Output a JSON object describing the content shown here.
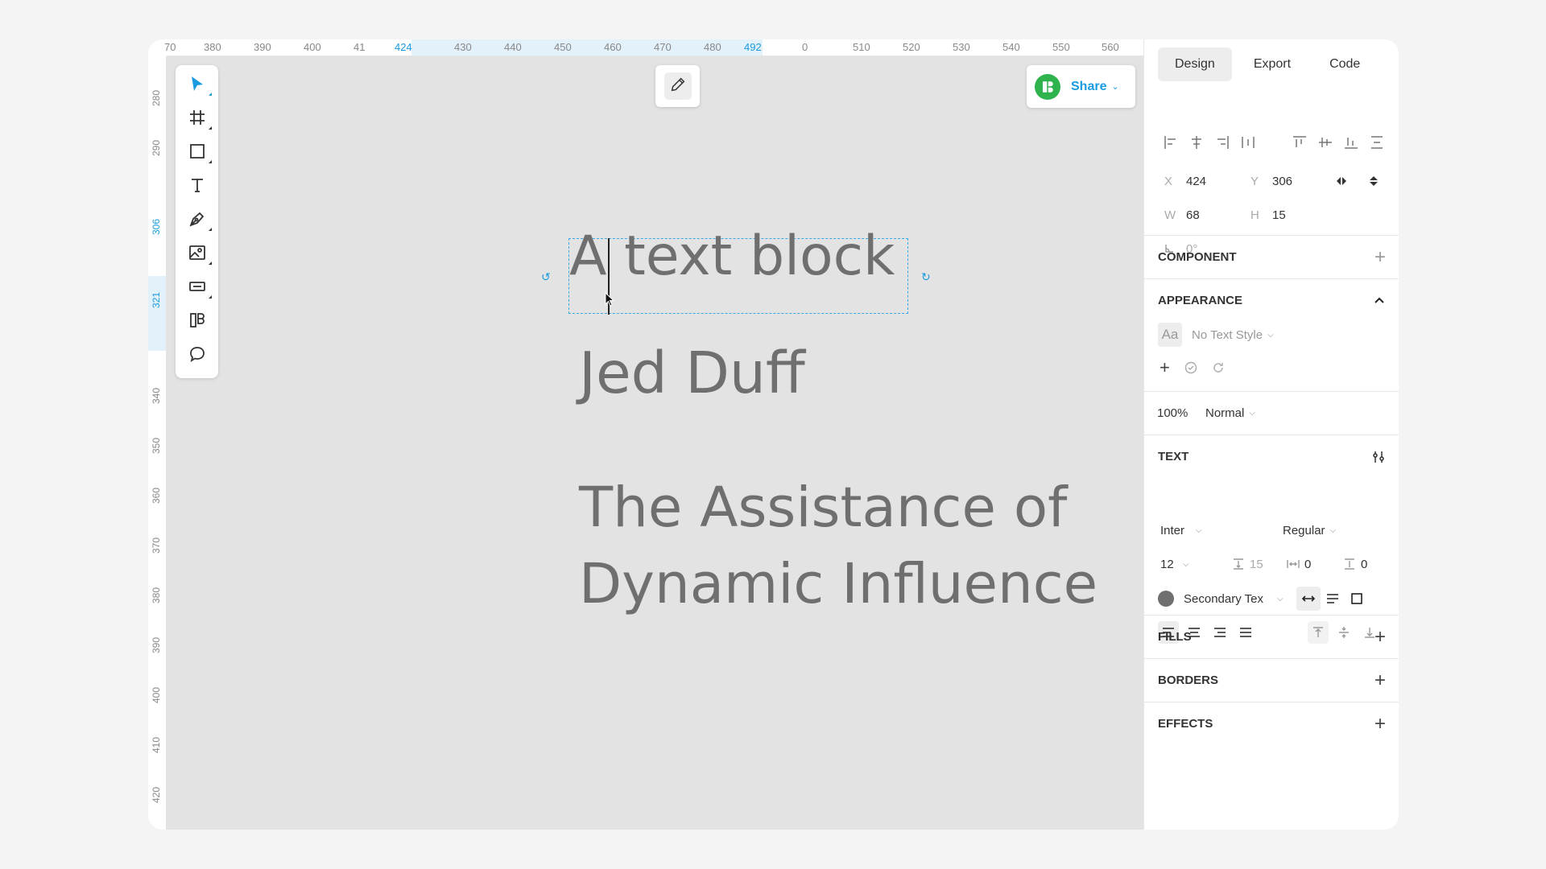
{
  "colors": {
    "accent": "#1a9be0",
    "canvas": "#e3e3e3",
    "text_layer": "#6f6f6f",
    "share_logo": "#2eb34f",
    "swatch": "#6f6f6f"
  },
  "ruler": {
    "x_labels": [
      "70",
      "380",
      "390",
      "400",
      "41",
      "424",
      "430",
      "440",
      "450",
      "460",
      "470",
      "480",
      "492",
      "0",
      "510",
      "520",
      "530",
      "540",
      "550",
      "560"
    ],
    "y_labels": [
      "280",
      "290",
      "306",
      "321",
      "340",
      "350",
      "360",
      "370",
      "380",
      "390",
      "400",
      "410",
      "420"
    ]
  },
  "toolbar": {
    "tools": [
      {
        "name": "select-tool",
        "icon": "cursor-arrow-icon"
      },
      {
        "name": "frame-tool",
        "icon": "frame-hash-icon"
      },
      {
        "name": "rectangle-tool",
        "icon": "rectangle-icon"
      },
      {
        "name": "text-tool",
        "icon": "text-t-icon"
      },
      {
        "name": "pen-tool",
        "icon": "pen-nib-icon"
      },
      {
        "name": "image-tool",
        "icon": "image-icon"
      },
      {
        "name": "component-tool",
        "icon": "component-bar-icon"
      },
      {
        "name": "library-tool",
        "icon": "library-icon"
      },
      {
        "name": "comment-tool",
        "icon": "speech-bubble-icon"
      }
    ]
  },
  "share": {
    "label": "Share"
  },
  "canvas": {
    "selected_text": "A text block",
    "text_2": "Jed Duff",
    "text_3_line1": "The Assistance of",
    "text_3_line2": "Dynamic Influence"
  },
  "panel": {
    "tabs": [
      "Design",
      "Export",
      "Code"
    ],
    "active_tab": "Design",
    "x_label": "X",
    "x_value": "424",
    "y_label": "Y",
    "y_value": "306",
    "w_label": "W",
    "w_value": "68",
    "h_label": "H",
    "h_value": "15",
    "rotation": "0°",
    "component_title": "COMPONENT",
    "appearance_title": "APPEARANCE",
    "text_style_icon": "Aa",
    "text_style": "No Text Style",
    "opacity": "100%",
    "blend": "Normal",
    "text_title": "TEXT",
    "font_family": "Inter",
    "font_weight": "Regular",
    "font_size": "12",
    "line_height": "15",
    "letter_spacing": "0",
    "paragraph_spacing": "0",
    "color_name": "Secondary Tex",
    "fills_title": "FILLS",
    "borders_title": "BORDERS",
    "effects_title": "EFFECTS"
  }
}
